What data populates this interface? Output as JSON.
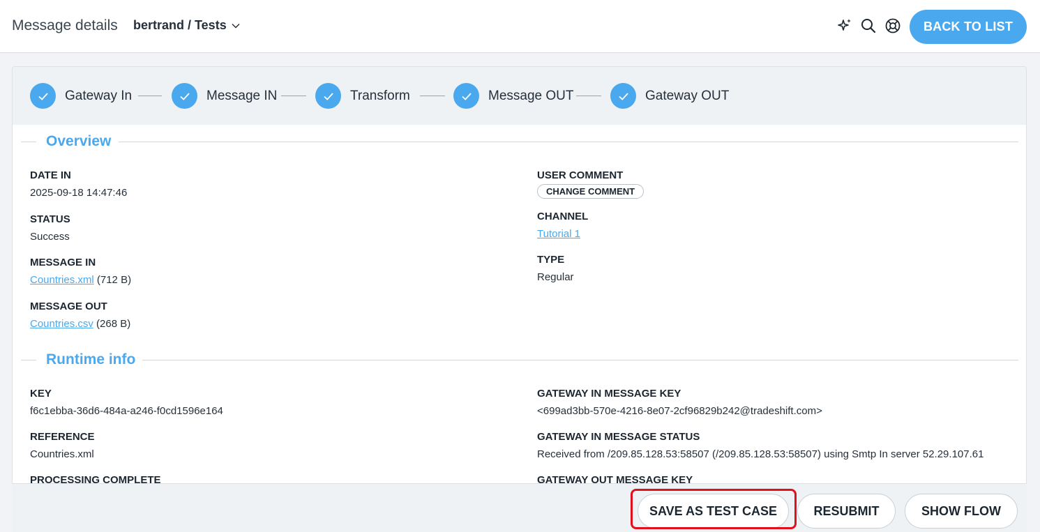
{
  "header": {
    "title": "Message details",
    "breadcrumb": "bertrand / Tests",
    "back_label": "BACK TO LIST",
    "icons": [
      "sparkle-icon",
      "search-icon",
      "help-lifebuoy-icon"
    ]
  },
  "steps": [
    {
      "label": "Gateway In"
    },
    {
      "label": "Message IN"
    },
    {
      "label": "Transform"
    },
    {
      "label": "Message OUT"
    },
    {
      "label": "Gateway OUT"
    }
  ],
  "overview": {
    "title": "Overview",
    "date_in": {
      "label": "DATE IN",
      "value": "2025-09-18 14:47:46"
    },
    "status": {
      "label": "STATUS",
      "value": "Success"
    },
    "message_in": {
      "label": "MESSAGE IN",
      "file": "Countries.xml",
      "size": "(712 B)"
    },
    "message_out": {
      "label": "MESSAGE OUT",
      "file": "Countries.csv",
      "size": "(268 B)"
    },
    "user_comment": {
      "label": "USER COMMENT",
      "button": "CHANGE COMMENT"
    },
    "channel": {
      "label": "CHANNEL",
      "value": "Tutorial 1"
    },
    "type": {
      "label": "TYPE",
      "value": "Regular"
    }
  },
  "runtime": {
    "title": "Runtime info",
    "key": {
      "label": "KEY",
      "value": "f6c1ebba-36d6-484a-a246-f0cd1596e164"
    },
    "reference": {
      "label": "REFERENCE",
      "value": "Countries.xml"
    },
    "processing_complete": {
      "label": "PROCESSING COMPLETE"
    },
    "gw_in_key": {
      "label": "GATEWAY IN MESSAGE KEY",
      "value": "<699ad3bb-570e-4216-8e07-2cf96829b242@tradeshift.com>"
    },
    "gw_in_status": {
      "label": "GATEWAY IN MESSAGE STATUS",
      "value": "Received from /209.85.128.53:58507 (/209.85.128.53:58507) using Smtp In server 52.29.107.61"
    },
    "gw_out_key": {
      "label": "GATEWAY OUT MESSAGE KEY"
    }
  },
  "footer": {
    "save_test_case": "SAVE AS TEST CASE",
    "resubmit": "RESUBMIT",
    "show_flow": "SHOW FLOW"
  },
  "colors": {
    "accent": "#4aa8ee",
    "highlight": "#e0101c"
  }
}
